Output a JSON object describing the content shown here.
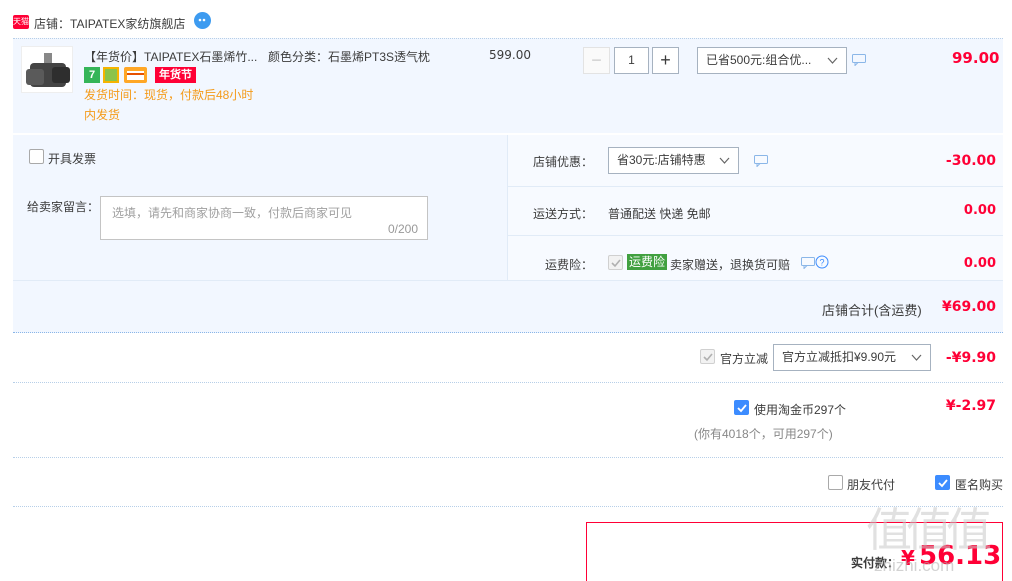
{
  "shop": {
    "badge": "天猫",
    "label": "店铺：TAIPATEX家纺旗舰店"
  },
  "item": {
    "title": "【年货价】TAIPATEX石墨烯竹...",
    "sku": "颜色分类：石墨烯PT3S透气枕",
    "unit_price": "599.00",
    "quantity": "1",
    "tag_1": "7",
    "tag_festival": "年货节",
    "ship_time": "发货时间：现货，付款后48小时",
    "ship_from": "内发货",
    "discount_select": "已省500元:组合优...",
    "subtotal": "99.00"
  },
  "invoice": {
    "label": "开具发票"
  },
  "message": {
    "label": "给卖家留言：",
    "placeholder": "选填，请先和商家协商一致，付款后商家可见",
    "counter": "0/200"
  },
  "store_discount": {
    "label": "店铺优惠：",
    "select": "省30元:店铺特惠",
    "amount": "-30.00"
  },
  "shipping": {
    "label": "运送方式：",
    "value": "普通配送 快递 免邮",
    "amount": "0.00"
  },
  "insurance": {
    "label": "运费险：",
    "tag": "运费险",
    "desc": "卖家赠送，退换货可赔",
    "amount": "0.00"
  },
  "store_total": {
    "label": "店铺合计(含运费)",
    "amount": "¥69.00"
  },
  "official": {
    "label": "官方立减",
    "select": "官方立减抵扣¥9.90元",
    "amount": "-¥9.90"
  },
  "coins": {
    "label": "使用淘金币297个",
    "sub": "(你有4018个，可用297个)",
    "amount": "¥-2.97"
  },
  "options": {
    "friend_pay": "朋友代付",
    "anonymous": "匿名购买"
  },
  "pay": {
    "label": "实付款：",
    "currency": "¥",
    "amount": "56.13"
  },
  "watermark": {
    "big": "值值值",
    "site": "zhizhi.com"
  },
  "colors": {
    "accent_red": "#ff0036",
    "panel_blue": "#f2f7ff",
    "checkbox_blue": "#3c8cff"
  }
}
